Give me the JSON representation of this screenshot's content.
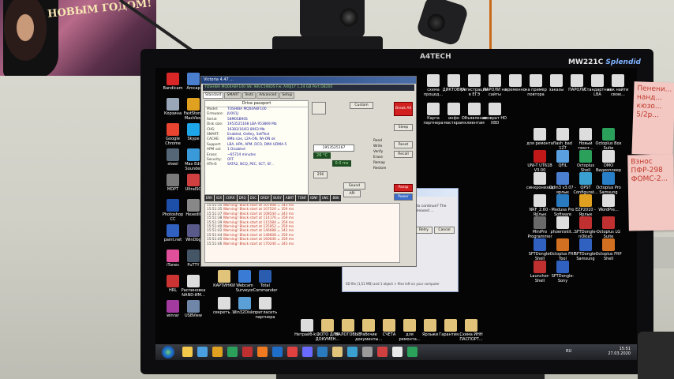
{
  "room": {
    "poster_text": "НОВЫМ ГОДОМ!",
    "monitor_brand": "A4TECH",
    "monitor_model_prefix": "MW221C",
    "monitor_model_suffix": "Splendid",
    "sticky1_text": "Пенени... нанд... кюзо... 5/2p...",
    "sticky2_text": "Взнос ПФР-298 ФОМС-2..."
  },
  "desktop": {
    "left_icons": [
      {
        "label": "Bandicam",
        "color": "#d92626"
      },
      {
        "label": "Amcap",
        "color": "#4a7fcf"
      },
      {
        "label": "Корзина",
        "color": "#9aa7b8"
      },
      {
        "label": "FastStone MaxView",
        "color": "#e0a020"
      },
      {
        "label": "Google Chrome",
        "color": "#e8442f"
      },
      {
        "label": "Skype",
        "color": "#1ea7e8"
      },
      {
        "label": "sheel",
        "color": "#556677"
      },
      {
        "label": "Max Edit Sounder",
        "color": "#3a9ad9"
      },
      {
        "label": "MDPT",
        "color": "#7a7a7a"
      },
      {
        "label": "UltraISO",
        "color": "#d04040"
      },
      {
        "label": "Photoshop CC",
        "color": "#1e4fa8"
      },
      {
        "label": "Hexedit",
        "color": "#888888"
      },
      {
        "label": "paint.net",
        "color": "#3060c0"
      },
      {
        "label": "WinDbg",
        "color": "#5a5a8a"
      },
      {
        "label": "iTunes",
        "color": "#e04f9a"
      },
      {
        "label": "PuTTY",
        "color": "#445566"
      },
      {
        "label": "HRL",
        "color": "#cc3333"
      },
      {
        "label": "Распиновка NAND-ИМ...",
        "color": "#dddddd"
      },
      {
        "label": "winrar",
        "color": "#a23aa0"
      },
      {
        "label": "USBView",
        "color": "#6f86a8"
      }
    ],
    "bottom_icons": [
      {
        "label": "КАРТИНКИ",
        "color": "#e2c37a"
      },
      {
        "label": "Webcam Surveyor",
        "color": "#3a7bd5"
      },
      {
        "label": "Total Commander",
        "color": "#2a5db0"
      },
      {
        "label": "секретъ ...",
        "color": "#dddddd"
      },
      {
        "label": "Win32Disk...",
        "color": "#5a9fd5"
      },
      {
        "label": "пригласить партнера",
        "color": "#dddddd"
      },
      {
        "label": "Нетрайб-k...",
        "color": "#dddddd"
      },
      {
        "label": "ФОТО ДЛЯ ДОКУМЕН...",
        "color": "#e2c37a"
      },
      {
        "label": "НАЛОГОВЫЕ",
        "color": "#e2c37a"
      },
      {
        "label": "Рабочие документы...",
        "color": "#e2c37a"
      },
      {
        "label": "СЧЕТА",
        "color": "#e2c37a"
      },
      {
        "label": "для ремонта...",
        "color": "#e2c37a"
      },
      {
        "label": "Ярлыки",
        "color": "#e2c37a"
      },
      {
        "label": "Гарантия...",
        "color": "#e2c37a"
      },
      {
        "label": "Схема ИНН ПАСПОРТ...",
        "color": "#e2c37a"
      }
    ],
    "top_right_icons": [
      {
        "label": "схема процед...",
        "color": "#dddddd"
      },
      {
        "label": "ДИКТОВКА",
        "color": "#dddddd"
      },
      {
        "label": "регистрация в ЕГЭ",
        "color": "#dddddd"
      },
      {
        "label": "ПАРОЛИ на сайты",
        "color": "#dddddd"
      },
      {
        "label": "временно",
        "color": "#dddddd"
      },
      {
        "label": "на пример повтора",
        "color": "#dddddd"
      },
      {
        "label": "заказы",
        "color": "#dddddd"
      },
      {
        "label": "ПАРОЛИ",
        "color": "#dddddd"
      },
      {
        "label": "Стандартные LBA",
        "color": "#dddddd"
      },
      {
        "label": "как найти свою...",
        "color": "#dddddd"
      },
      {
        "label": "Карта партнера",
        "color": "#dddddd"
      },
      {
        "label": "инфо мастерам",
        "color": "#dddddd"
      },
      {
        "label": "Объявление клиентам",
        "color": "#dddddd"
      },
      {
        "label": "возврат HD XBD",
        "color": "#dddddd"
      }
    ],
    "mid_right_icons": [
      {
        "label": "для ремонта",
        "color": "#dddddd"
      },
      {
        "label": "flash_bad 127",
        "color": "#dddddd"
      },
      {
        "label": "Новый текст...",
        "color": "#dddddd"
      },
      {
        "label": "Octoplus Box Suite",
        "color": "#2aa05a"
      },
      {
        "label": "UNI-T UT61B V3.00",
        "color": "#c01818"
      },
      {
        "label": "QFIL",
        "color": "#5aa0e0"
      },
      {
        "label": "Octoplus Shell",
        "color": "#2aa05a"
      },
      {
        "label": "DMO Видеоплеер",
        "color": "#dddddd"
      },
      {
        "label": "синхронизация",
        "color": "#dddddd"
      },
      {
        "label": "Odin3 v3.07 - ярлык",
        "color": "#4a7fcf"
      },
      {
        "label": "QPST Configurat...",
        "color": "#3aa0d0"
      },
      {
        "label": "Octoplus Pro Samsung",
        "color": "#2a80c8"
      },
      {
        "label": "NRF_2.60 - Ярлык",
        "color": "#dddddd"
      },
      {
        "label": "Medusa Pro Software",
        "color": "#2a7ac0"
      },
      {
        "label": "EZP2010 - Ярлык",
        "color": "#e0a020"
      },
      {
        "label": "WordPre...",
        "color": "#dddddd"
      },
      {
        "label": "MiniPro Programmer",
        "color": "#6a6a6a"
      },
      {
        "label": "phoenixkit...",
        "color": "#dddddd"
      },
      {
        "label": "SFTDongle-nOkia5",
        "color": "#c03030"
      },
      {
        "label": "Octoplus LG Suite",
        "color": "#c03030"
      },
      {
        "label": "SFTDongle-Shell",
        "color": "#3060c0"
      },
      {
        "label": "Octoplus FRP Tool",
        "color": "#d07020"
      },
      {
        "label": "SFTDongle-Samsung",
        "color": "#3060c0"
      },
      {
        "label": "Octoplus FRP Shell",
        "color": "#d07020"
      },
      {
        "label": "Launcher-Shell",
        "color": "#c03030"
      },
      {
        "label": "SFTDongle-Sony",
        "color": "#3060c0"
      }
    ]
  },
  "victoria": {
    "title": "Victoria 4.47 ...",
    "drive_bar": "TOSHIBA MQ04ABF100   SN: 98UC590DS   Fw: AX0J1Y   1.24 GB   Port DB200",
    "tabs": [
      "Standard",
      "SMART",
      "Tests",
      "Advanced",
      "Setup"
    ],
    "passport_title": "Drive passport",
    "passport": [
      {
        "k": "Model:",
        "v": "TOSHIBA MQ04ABF100"
      },
      {
        "k": "Firmware:",
        "v": "JU001J"
      },
      {
        "k": "Serial:",
        "v": "58M0SB90S"
      },
      {
        "k": "Disk size:",
        "v": "1953525168 LBA     953869 Mb"
      },
      {
        "k": "CHS:",
        "v": "16383/16/63           8063 Mb"
      },
      {
        "k": "SMART:",
        "v": "Enabled, OnKey, SelfTest"
      },
      {
        "k": "CACHE:",
        "v": "8Mb size, L2A-ON, Wr-ON  ok"
      },
      {
        "k": "Support:",
        "v": "LBA, HPA, APM, DCO, DMA    UDMA-5"
      },
      {
        "k": "APM val:",
        "v": "1                     Disabled"
      },
      {
        "k": "Erase:",
        "v": "~65724 minutes"
      },
      {
        "k": "Security:",
        "v": "OFF"
      },
      {
        "k": "ATA-6:",
        "v": "SATA2, NCQ, PEC, SCT, SF..."
      }
    ],
    "controls": {
      "port_label": "Port DB200",
      "custom": "Custom",
      "lba_value": "1953525167",
      "temp": "26 °C",
      "speed": "0.0 ms",
      "blocks": "256",
      "break_all": "Break All",
      "sleep": "Sleep",
      "reset": "Reset",
      "recall": "Recall",
      "passp": "Passp",
      "power": "Power",
      "options": [
        "Read",
        "Write",
        "Verify",
        "Erase",
        "Remap",
        "Restore"
      ],
      "sound": "Sound",
      "api": "API"
    },
    "status_labels": [
      "ERR",
      "IDX",
      "CORR",
      "DRQ",
      "DSC",
      "DRDY",
      "BUSY",
      "ABRT",
      "TONF",
      "IDNF",
      "UNC",
      "BBK"
    ],
    "log": [
      {
        "ts": "15:51:35",
        "msg": "Warning! Block start at 107008 = 343 ms"
      },
      {
        "ts": "15:51:35",
        "msg": "Warning! Block start at 107520 = 359 ms"
      },
      {
        "ts": "15:51:37",
        "msg": "Warning! Block start at 108544 = 343 ms"
      },
      {
        "ts": "15:51:38",
        "msg": "Warning! Block start at 114176 = 359 ms"
      },
      {
        "ts": "15:51:39",
        "msg": "Warning! Block start at 115584 = 359 ms"
      },
      {
        "ts": "15:51:40",
        "msg": "Warning! Block start at 125952 = 359 ms"
      },
      {
        "ts": "15:51:42",
        "msg": "Warning! Block start at 146688 = 343 ms"
      },
      {
        "ts": "15:51:44",
        "msg": "Warning! Block start at 148608 = 359 ms"
      },
      {
        "ts": "15:51:45",
        "msg": "Warning! Block start at 160640 = 359 ms"
      },
      {
        "ts": "15:51:46",
        "msg": "Warning! Block start at 170240 = 343 ms"
      }
    ]
  },
  "dialog": {
    "text": "Do you want to continue? The USB will be released ...",
    "buttons": [
      "Retry",
      "Cancel"
    ],
    "bottom": "SD file (1,51 MB) and 1 object + files left on your computer"
  },
  "taskbar": {
    "apps": [
      "#f3c84b",
      "#4a9fe0",
      "#e0a020",
      "#2aa05a",
      "#c03030",
      "#f07a20",
      "#1e6ec9",
      "#e04040",
      "#6a6aff",
      "#2a7ac0",
      "#e2c37a",
      "#3aa0d0",
      "#9a9a9a",
      "#d04040",
      "#e8e8e8",
      "#2aa05a"
    ],
    "time": "15:51",
    "date": "27.03.2020",
    "lang": "RU"
  }
}
